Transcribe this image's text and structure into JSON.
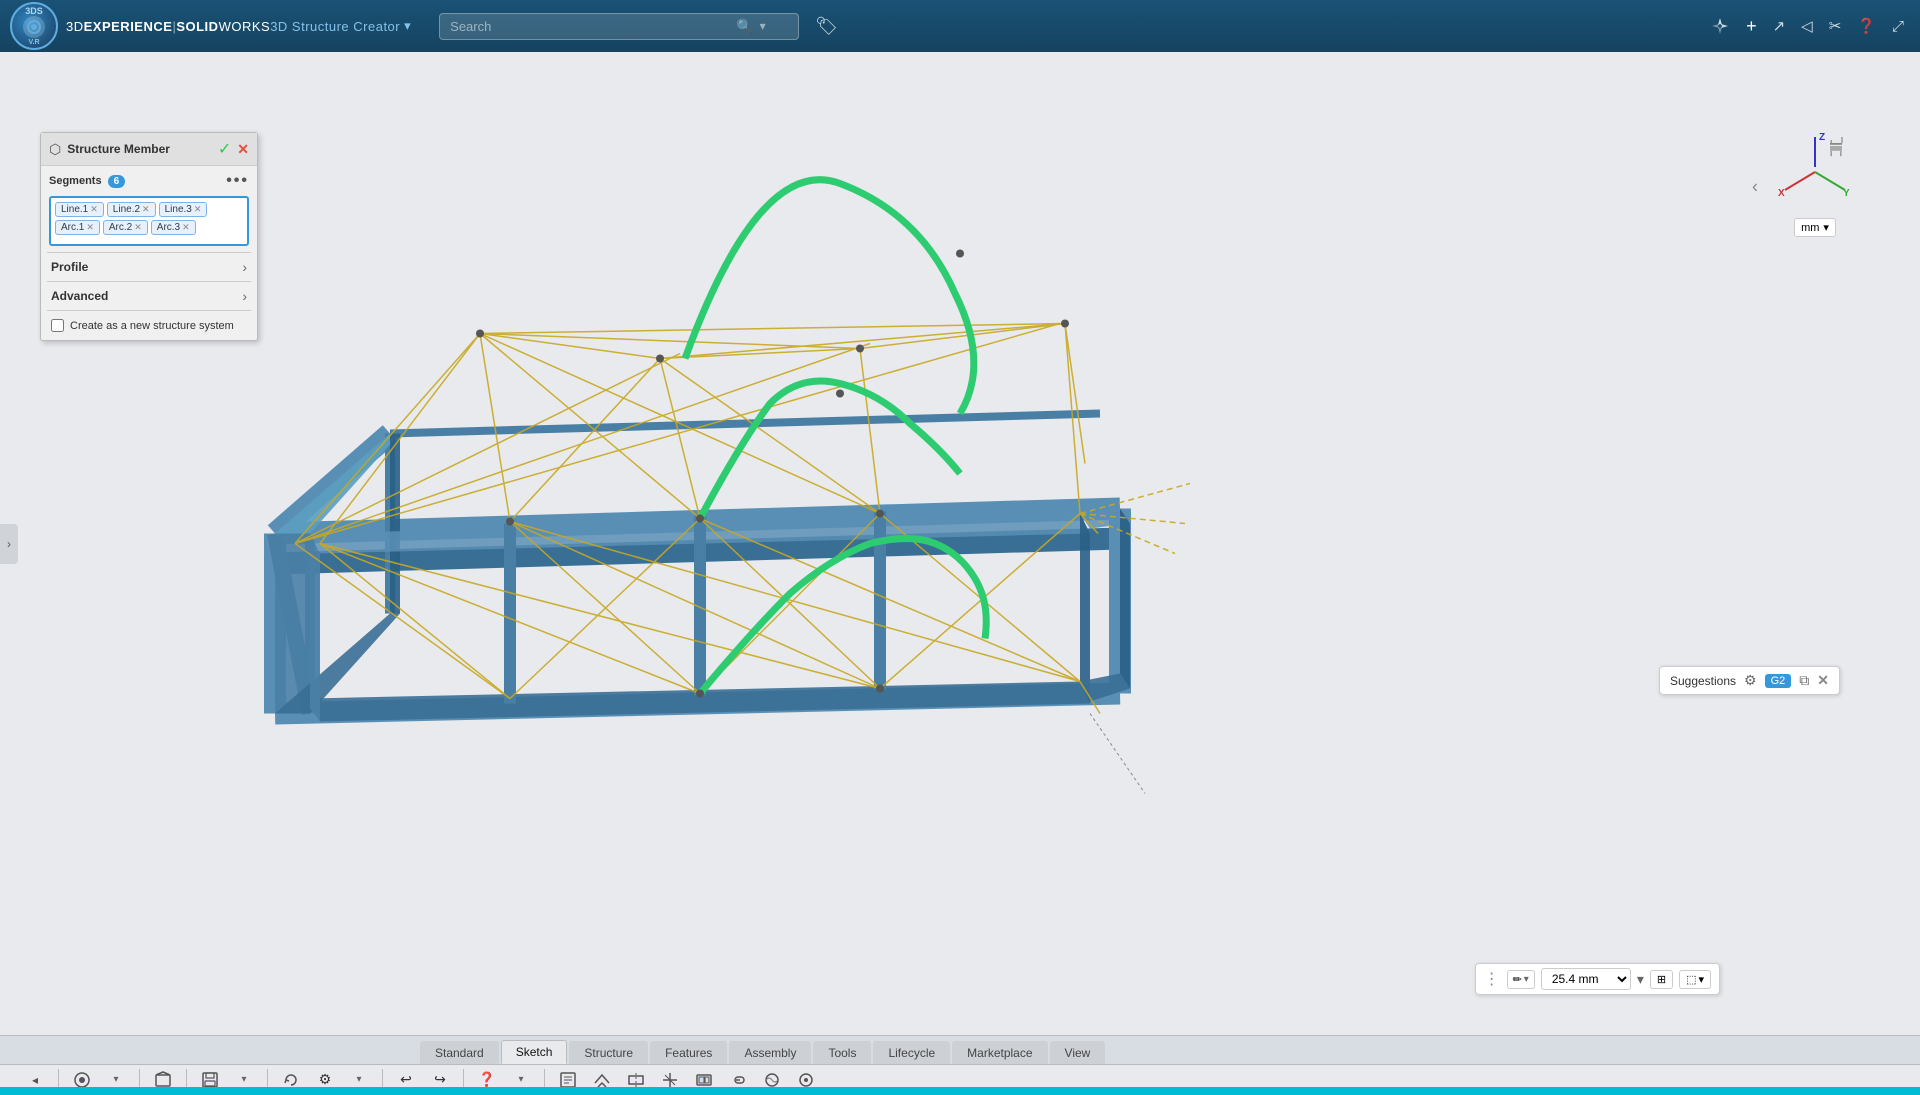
{
  "app": {
    "logo_text": "3DS",
    "title_prefix": "3D",
    "title_bold": "EXPERIENCE",
    "title_separator": " | ",
    "title_brand": "SOLIDWORKS",
    "title_product": " 3D Structure Creator",
    "dropdown_arrow": "▾"
  },
  "search": {
    "placeholder": "Search"
  },
  "header": {
    "icons": [
      "⬟",
      "＋",
      "↷",
      "◁",
      "✂",
      "❓",
      "⤢"
    ]
  },
  "panel": {
    "title": "Structure Member",
    "ok_symbol": "✓",
    "close_symbol": "✕",
    "segments_label": "Segments",
    "segments_count": "6",
    "segments_row1": [
      "Line.1",
      "Line.2",
      "Line.3"
    ],
    "segments_row2": [
      "Arc.1",
      "Arc.2",
      "Arc.3"
    ],
    "more_symbol": "•••",
    "profile_label": "Profile",
    "advanced_label": "Advanced",
    "new_system_label": "Create as a new structure system",
    "arrow_symbol": "›"
  },
  "orientation": {
    "unit": "mm",
    "chevron": "‹",
    "axis_x": "X",
    "axis_y": "Y",
    "axis_z": "Z"
  },
  "suggestions": {
    "label": "Suggestions",
    "gear_symbol": "⚙",
    "badge": "G2",
    "copy_symbol": "⧉",
    "close_symbol": "✕"
  },
  "measure": {
    "dots": "⋮",
    "icon_symbol": "✏",
    "value": "25.4 mm",
    "dropdown_symbol": "▾",
    "icon2_symbol": "⊞",
    "icon3_symbol": "⬚",
    "arrow_symbol": "▾"
  },
  "tabs": [
    {
      "label": "Standard",
      "active": false
    },
    {
      "label": "Sketch",
      "active": true
    },
    {
      "label": "Structure",
      "active": false
    },
    {
      "label": "Features",
      "active": false
    },
    {
      "label": "Assembly",
      "active": false
    },
    {
      "label": "Tools",
      "active": false
    },
    {
      "label": "Lifecycle",
      "active": false
    },
    {
      "label": "Marketplace",
      "active": false
    },
    {
      "label": "View",
      "active": false
    }
  ],
  "toolbar": {
    "items": [
      {
        "symbol": "⊕",
        "name": "select-tool"
      },
      {
        "symbol": "▾",
        "name": "select-dropdown"
      },
      {
        "symbol": "📦",
        "name": "box-tool"
      },
      {
        "symbol": "💾",
        "name": "save-tool"
      },
      {
        "symbol": "▾",
        "name": "save-dropdown"
      },
      {
        "symbol": "🔄",
        "name": "rebuild-tool"
      },
      {
        "symbol": "⚙",
        "name": "settings-tool"
      },
      {
        "symbol": "▾",
        "name": "settings-dropdown"
      },
      {
        "symbol": "↩",
        "name": "undo-tool"
      },
      {
        "symbol": "↪",
        "name": "redo-tool"
      },
      {
        "symbol": "❓",
        "name": "help-tool"
      },
      {
        "symbol": "▾",
        "name": "help-dropdown"
      },
      {
        "symbol": "📋",
        "name": "note-tool"
      },
      {
        "symbol": "🎲",
        "name": "view3d-tool"
      },
      {
        "symbol": "◈",
        "name": "section-tool"
      },
      {
        "symbol": "⌖",
        "name": "ref-tool"
      },
      {
        "symbol": "⬚",
        "name": "display-tool"
      },
      {
        "symbol": "🔗",
        "name": "link-tool"
      },
      {
        "symbol": "🔵",
        "name": "appearance-tool"
      },
      {
        "symbol": "◎",
        "name": "circle-tool"
      }
    ]
  },
  "colors": {
    "header_bg": "#1a5276",
    "tab_active_bg": "#e8eaed",
    "tab_inactive_bg": "#cdd1d6",
    "structure_blue": "#4a7fa5",
    "structure_yellow": "#c8a820",
    "structure_green": "#2ecc71",
    "viewport_bg": "#e8eaed"
  }
}
